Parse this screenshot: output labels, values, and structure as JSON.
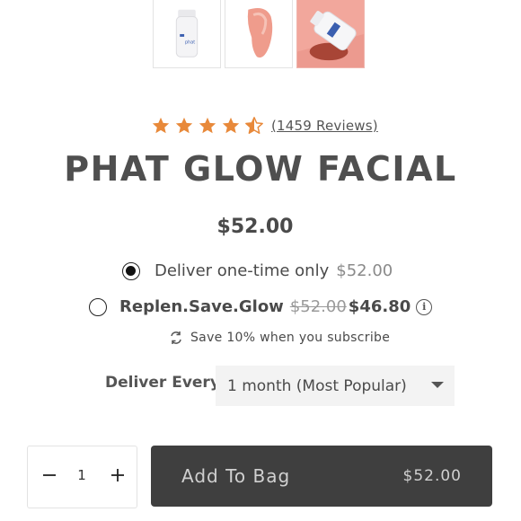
{
  "gallery": {
    "thumbnails": [
      "bottle-image",
      "swatch-image",
      "bottle-lifestyle-image"
    ],
    "bottle_label": "phat"
  },
  "product": {
    "rating": 4.5,
    "reviews_label": "(1459 Reviews)",
    "title": "PHAT GLOW FACIAL",
    "price": "$52.00"
  },
  "purchase_options": {
    "one_time": {
      "label": "Deliver one-time only",
      "price": "$52.00",
      "selected": true
    },
    "subscribe": {
      "label": "Replen.Save.Glow",
      "original_price": "$52.00",
      "discount_price": "$46.80",
      "info_icon": "info-icon",
      "selected": false
    },
    "save_note": "Save 10% when you subscribe",
    "save_icon": "refresh-icon"
  },
  "delivery": {
    "label": "Deliver Every",
    "selected": "1 month (Most Popular)"
  },
  "cart": {
    "quantity": "1",
    "add_label": "Add To Bag",
    "price": "$52.00"
  },
  "colors": {
    "star": "#e8893a",
    "button_bg": "#3f3f3f",
    "accent_pink": "#f0b5ad"
  }
}
